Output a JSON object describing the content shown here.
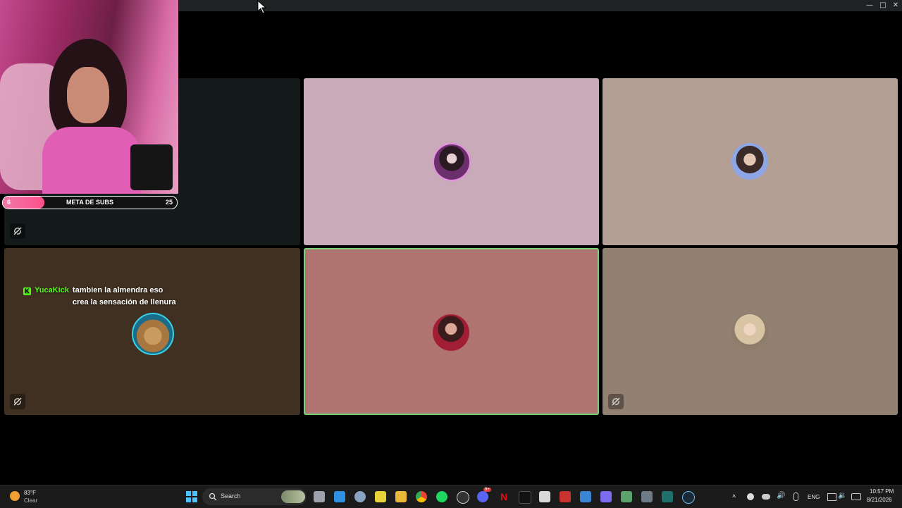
{
  "window": {
    "minimize_glyph": "—",
    "maximize_glyph": "□",
    "close_glyph": "✕"
  },
  "overlay": {
    "sub_goal": {
      "label": "META DE SUBS",
      "current": "6",
      "target": "25",
      "progress_fraction": 0.24
    }
  },
  "tiles": [
    {
      "id": "tile-1",
      "color": "#141a1a",
      "muted": true,
      "has_avatar": false
    },
    {
      "id": "tile-2",
      "color": "#c9aab8",
      "muted": false,
      "avatar": "avatar-icon"
    },
    {
      "id": "tile-3",
      "color": "#b39f93",
      "muted": false,
      "avatar": "avatar-icon"
    },
    {
      "id": "tile-4",
      "color": "#3f3021",
      "muted": true,
      "avatar": "teddy-bear-avatar-icon"
    },
    {
      "id": "tile-5",
      "color": "#b07470",
      "muted": false,
      "active_speaker": true,
      "avatar": "avatar-icon"
    },
    {
      "id": "tile-6",
      "color": "#928070",
      "muted": true,
      "avatar": "avatar-icon"
    }
  ],
  "chat": {
    "platform_icon": "kick-icon",
    "username": "YucaKick",
    "message": "tambien la almendra eso crea la sensación de llenura"
  },
  "taskbar": {
    "weather": {
      "temp": "83°F",
      "condition": "Clear"
    },
    "search_placeholder": "Search",
    "tray": {
      "language": "ENG",
      "time": "10:57 PM",
      "date": "8/21/2026"
    },
    "discord_badge": "9+",
    "accent": "#53fc18"
  }
}
